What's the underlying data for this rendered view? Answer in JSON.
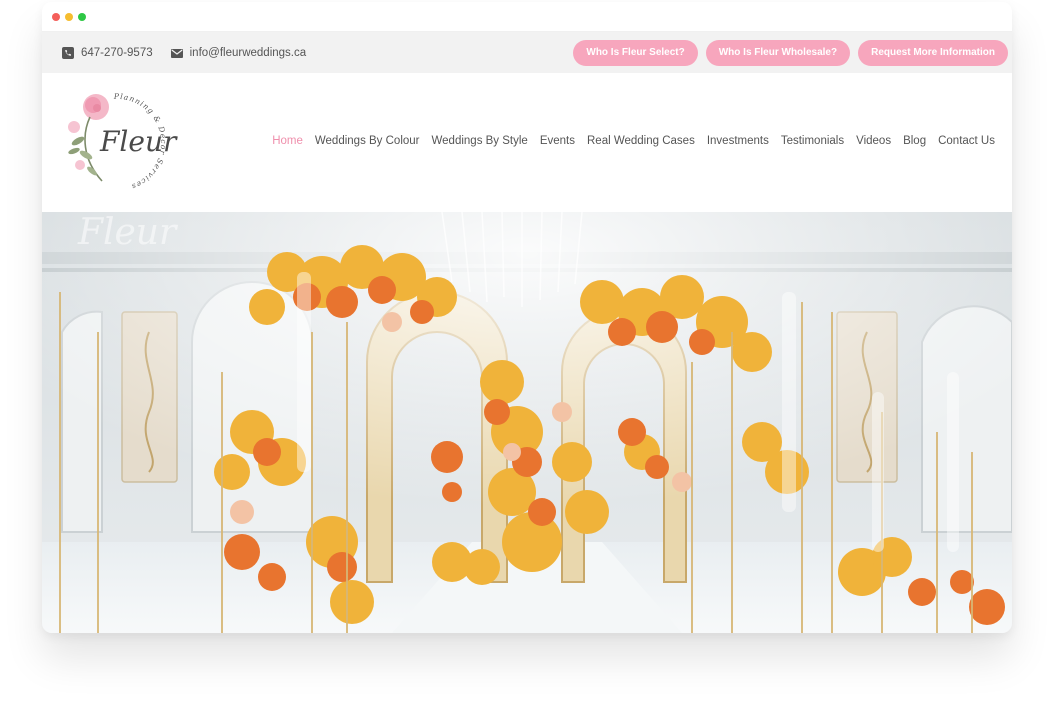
{
  "topbar": {
    "phone": "647-270-9573",
    "email": "info@fleurweddings.ca",
    "buttons": [
      {
        "label": "Who Is Fleur Select?"
      },
      {
        "label": "Who Is Fleur Wholesale?"
      },
      {
        "label": "Request More Information"
      }
    ]
  },
  "logo": {
    "wordmark": "Fleur",
    "ring_text": "Planning & Decor Services"
  },
  "nav": {
    "items": [
      {
        "label": "Home",
        "active": true
      },
      {
        "label": "Weddings By Colour"
      },
      {
        "label": "Weddings By Style"
      },
      {
        "label": "Events"
      },
      {
        "label": "Real Wedding Cases"
      },
      {
        "label": "Investments"
      },
      {
        "label": "Testimonials"
      },
      {
        "label": "Videos"
      },
      {
        "label": "Blog"
      },
      {
        "label": "Contact Us"
      }
    ]
  },
  "hero": {
    "watermark": "Fleur"
  },
  "colors": {
    "accent_pink": "#f7a6bd",
    "nav_active": "#ef8fac",
    "topbar_bg": "#f2f2f2"
  },
  "icons": {
    "phone": "phone-icon",
    "email": "envelope-icon"
  }
}
